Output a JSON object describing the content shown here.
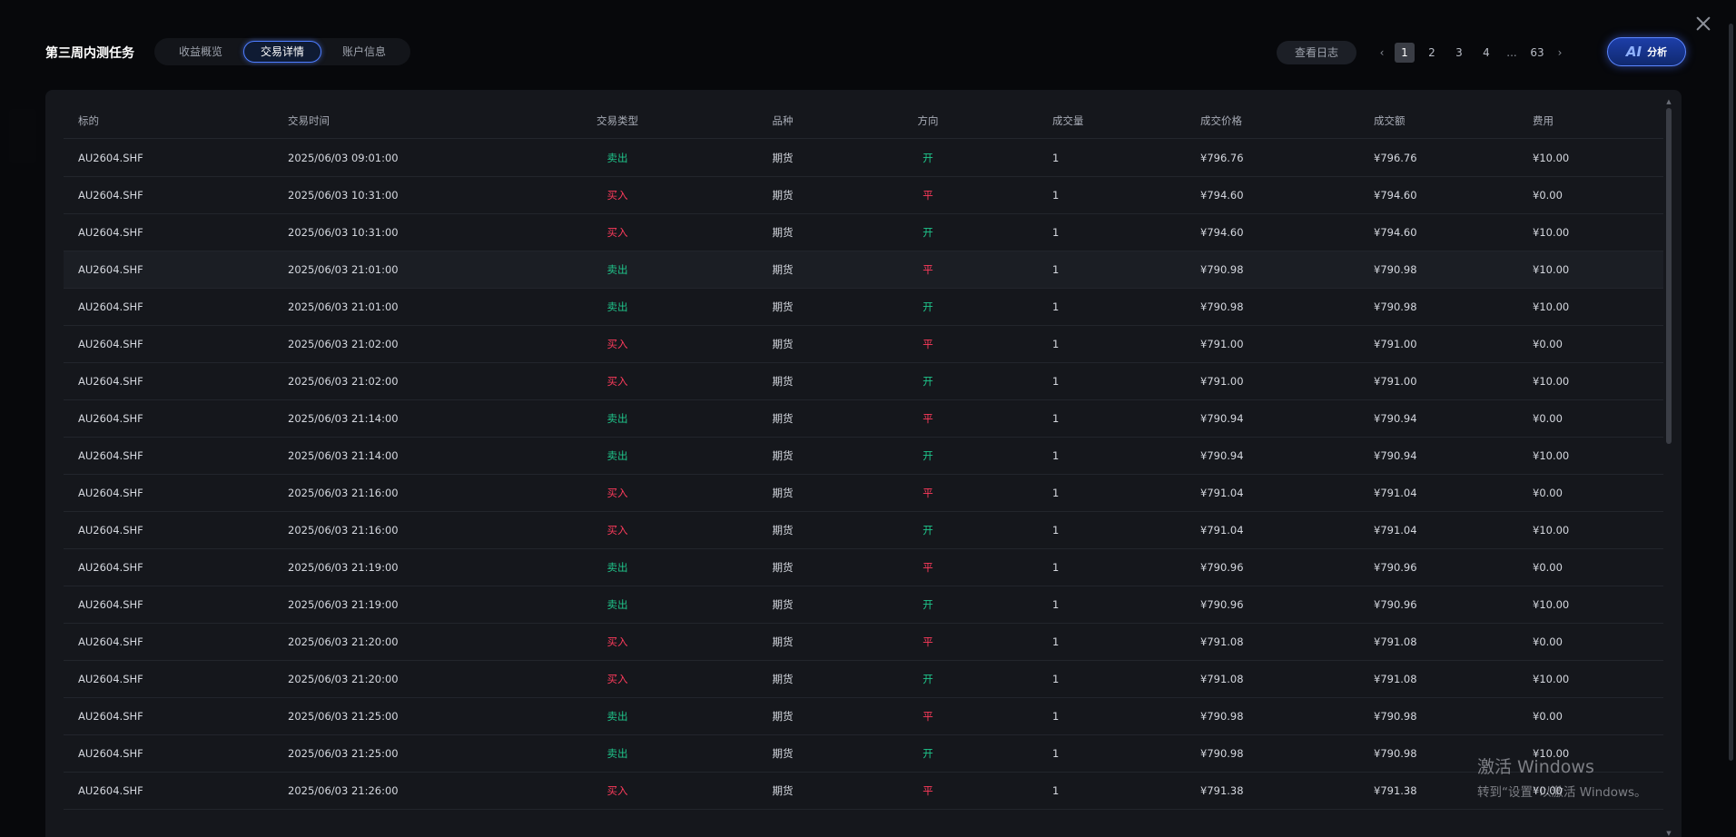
{
  "header": {
    "title": "第三周内测任务",
    "tabs": [
      {
        "label": "收益概览"
      },
      {
        "label": "交易详情"
      },
      {
        "label": "账户信息"
      }
    ],
    "log_button": "查看日志",
    "pagination": {
      "pages": [
        "1",
        "2",
        "3",
        "4"
      ],
      "ellipsis": "...",
      "last": "63",
      "current": "1"
    },
    "ai_button": {
      "mark": "AI",
      "label": "分析"
    }
  },
  "table": {
    "columns": [
      "标的",
      "交易时间",
      "交易类型",
      "品种",
      "方向",
      "成交量",
      "成交价格",
      "成交额",
      "费用"
    ],
    "rows": [
      {
        "symbol": "AU2604.SHF",
        "time": "2025/06/03 09:01:00",
        "type": "卖出",
        "kind": "期货",
        "dir": "开",
        "qty": "1",
        "price": "¥796.76",
        "amount": "¥796.76",
        "fee": "¥10.00"
      },
      {
        "symbol": "AU2604.SHF",
        "time": "2025/06/03 10:31:00",
        "type": "买入",
        "kind": "期货",
        "dir": "平",
        "qty": "1",
        "price": "¥794.60",
        "amount": "¥794.60",
        "fee": "¥0.00"
      },
      {
        "symbol": "AU2604.SHF",
        "time": "2025/06/03 10:31:00",
        "type": "买入",
        "kind": "期货",
        "dir": "开",
        "qty": "1",
        "price": "¥794.60",
        "amount": "¥794.60",
        "fee": "¥10.00"
      },
      {
        "symbol": "AU2604.SHF",
        "time": "2025/06/03 21:01:00",
        "type": "卖出",
        "kind": "期货",
        "dir": "平",
        "qty": "1",
        "price": "¥790.98",
        "amount": "¥790.98",
        "fee": "¥10.00"
      },
      {
        "symbol": "AU2604.SHF",
        "time": "2025/06/03 21:01:00",
        "type": "卖出",
        "kind": "期货",
        "dir": "开",
        "qty": "1",
        "price": "¥790.98",
        "amount": "¥790.98",
        "fee": "¥10.00"
      },
      {
        "symbol": "AU2604.SHF",
        "time": "2025/06/03 21:02:00",
        "type": "买入",
        "kind": "期货",
        "dir": "平",
        "qty": "1",
        "price": "¥791.00",
        "amount": "¥791.00",
        "fee": "¥0.00"
      },
      {
        "symbol": "AU2604.SHF",
        "time": "2025/06/03 21:02:00",
        "type": "买入",
        "kind": "期货",
        "dir": "开",
        "qty": "1",
        "price": "¥791.00",
        "amount": "¥791.00",
        "fee": "¥10.00"
      },
      {
        "symbol": "AU2604.SHF",
        "time": "2025/06/03 21:14:00",
        "type": "卖出",
        "kind": "期货",
        "dir": "平",
        "qty": "1",
        "price": "¥790.94",
        "amount": "¥790.94",
        "fee": "¥0.00"
      },
      {
        "symbol": "AU2604.SHF",
        "time": "2025/06/03 21:14:00",
        "type": "卖出",
        "kind": "期货",
        "dir": "开",
        "qty": "1",
        "price": "¥790.94",
        "amount": "¥790.94",
        "fee": "¥10.00"
      },
      {
        "symbol": "AU2604.SHF",
        "time": "2025/06/03 21:16:00",
        "type": "买入",
        "kind": "期货",
        "dir": "平",
        "qty": "1",
        "price": "¥791.04",
        "amount": "¥791.04",
        "fee": "¥0.00"
      },
      {
        "symbol": "AU2604.SHF",
        "time": "2025/06/03 21:16:00",
        "type": "买入",
        "kind": "期货",
        "dir": "开",
        "qty": "1",
        "price": "¥791.04",
        "amount": "¥791.04",
        "fee": "¥10.00"
      },
      {
        "symbol": "AU2604.SHF",
        "time": "2025/06/03 21:19:00",
        "type": "卖出",
        "kind": "期货",
        "dir": "平",
        "qty": "1",
        "price": "¥790.96",
        "amount": "¥790.96",
        "fee": "¥0.00"
      },
      {
        "symbol": "AU2604.SHF",
        "time": "2025/06/03 21:19:00",
        "type": "卖出",
        "kind": "期货",
        "dir": "开",
        "qty": "1",
        "price": "¥790.96",
        "amount": "¥790.96",
        "fee": "¥10.00"
      },
      {
        "symbol": "AU2604.SHF",
        "time": "2025/06/03 21:20:00",
        "type": "买入",
        "kind": "期货",
        "dir": "平",
        "qty": "1",
        "price": "¥791.08",
        "amount": "¥791.08",
        "fee": "¥0.00"
      },
      {
        "symbol": "AU2604.SHF",
        "time": "2025/06/03 21:20:00",
        "type": "买入",
        "kind": "期货",
        "dir": "开",
        "qty": "1",
        "price": "¥791.08",
        "amount": "¥791.08",
        "fee": "¥10.00"
      },
      {
        "symbol": "AU2604.SHF",
        "time": "2025/06/03 21:25:00",
        "type": "卖出",
        "kind": "期货",
        "dir": "平",
        "qty": "1",
        "price": "¥790.98",
        "amount": "¥790.98",
        "fee": "¥0.00"
      },
      {
        "symbol": "AU2604.SHF",
        "time": "2025/06/03 21:25:00",
        "type": "卖出",
        "kind": "期货",
        "dir": "开",
        "qty": "1",
        "price": "¥790.98",
        "amount": "¥790.98",
        "fee": "¥10.00"
      },
      {
        "symbol": "AU2604.SHF",
        "time": "2025/06/03 21:26:00",
        "type": "买入",
        "kind": "期货",
        "dir": "平",
        "qty": "1",
        "price": "¥791.38",
        "amount": "¥791.38",
        "fee": "¥0.00"
      }
    ],
    "highlighted_row": 3
  },
  "watermark": {
    "line1": "激活 Windows",
    "line2": "转到“设置”以激活 Windows。"
  },
  "colors": {
    "sell": "#1fc48a",
    "buy": "#ff3b5c",
    "accent": "#4d7cff"
  },
  "icons": [
    "close-icon",
    "chevron-left-icon",
    "chevron-right-icon"
  ]
}
